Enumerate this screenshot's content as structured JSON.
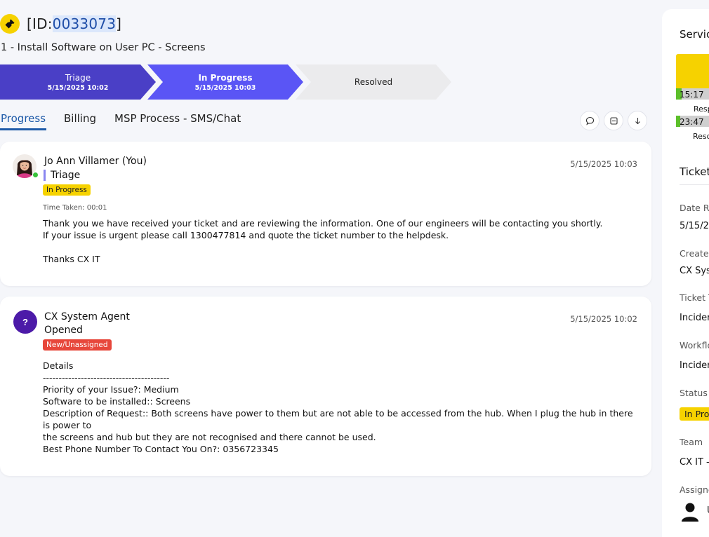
{
  "ticket": {
    "id_prefix": "[ID:",
    "id_number": "0033073",
    "id_suffix": "]",
    "title": "1 - Install Software on User PC - Screens"
  },
  "stages": [
    {
      "label": "Triage",
      "date": "5/15/2025 10:02",
      "color": "#4a3fc6"
    },
    {
      "label": "In Progress",
      "date": "5/15/2025 10:03",
      "color": "#5a55f5"
    },
    {
      "label": "Resolved",
      "date": "",
      "color": "#ebebed"
    }
  ],
  "tabs": [
    "Progress",
    "Billing",
    "MSP Process - SMS/Chat"
  ],
  "actions": {
    "icons": [
      "chat-bubble-icon",
      "minimize-icon",
      "arrow-down-icon"
    ]
  },
  "entries": [
    {
      "author": "Jo Ann Villamer (You)",
      "stage": "Triage",
      "status_badge": "In Progress",
      "timestamp": "5/15/2025 10:03",
      "time_taken": "Time Taken: 00:01",
      "body": [
        "Thank you we have received your ticket and are reviewing the information. One of our engineers will be contacting you shortly.",
        "If your issue is urgent please call 1300477814 and quote the ticket number to the helpdesk.",
        "",
        "Thanks CX IT"
      ]
    },
    {
      "author": "CX System Agent",
      "avatar_letter": "?",
      "stage": "Opened",
      "status_badge": "New/Unassigned",
      "timestamp": "5/15/2025 10:02",
      "body": [
        "Details",
        "----------------------------------------",
        "Priority of your Issue?: Medium",
        "Software to be installed:: Screens",
        "Description of Request:: Both screens have power to them but are not able to be accessed from the hub. When I plug the hub in there is power to",
        "the screens and hub but they are not recognised and there cannot be used.",
        "Best Phone Number To Contact You On?: 0356723345"
      ]
    }
  ],
  "right_panel": {
    "sla_heading": "Servic",
    "sla": [
      {
        "time": "15:17",
        "label": "Resp",
        "progress": 0.1
      },
      {
        "time": "23:47",
        "label": "Reso",
        "progress": 0.07
      }
    ],
    "ticket_heading": "Ticket",
    "fields": [
      {
        "label": "Date Re",
        "value": "5/15/20"
      },
      {
        "label": "Created",
        "value": "CX Syst"
      },
      {
        "label": "Ticket T",
        "value": "Incider"
      },
      {
        "label": "Workflo",
        "value": "Incider"
      },
      {
        "label": "Status",
        "value": "In Pro"
      },
      {
        "label": "Team",
        "value": "CX IT - "
      },
      {
        "label": "Assigne",
        "value": "U"
      }
    ]
  },
  "colors": {
    "accent_blue": "#1e5aa8",
    "status_yellow": "#f6d200",
    "status_red": "#e7473b",
    "agent_purple": "#4c1aa8"
  }
}
